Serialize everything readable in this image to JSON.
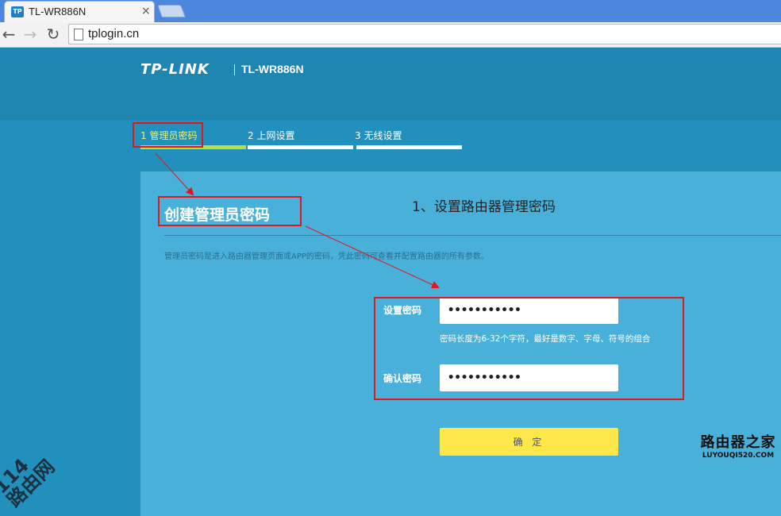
{
  "browser": {
    "tab_title": "TL-WR886N",
    "tab_favicon": "TP",
    "tab_close": "×",
    "back": "←",
    "forward": "→",
    "reload": "↻",
    "url": "tplogin.cn"
  },
  "header": {
    "brand": "TP-LINK",
    "model": "TL-WR886N"
  },
  "steps": [
    {
      "label": "1 管理员密码",
      "active": true
    },
    {
      "label": "2 上网设置",
      "active": false
    },
    {
      "label": "3 无线设置",
      "active": false
    }
  ],
  "panel": {
    "title": "创建管理员密码",
    "annotation": "1、设置路由器管理密码",
    "description": "管理员密码是进入路由器管理页面或APP的密码，凭此密码可查看并配置路由器的所有参数。"
  },
  "form": {
    "password_label": "设置密码",
    "password_value": "•••••••••••",
    "hint": "密码长度为6-32个字符，最好是数字、字母、符号的组合",
    "confirm_label": "确认密码",
    "confirm_value": "•••••••••••",
    "submit_label": "确 定"
  },
  "watermarks": {
    "left_line1": "114",
    "left_line2": "路由网",
    "right_main": "路由器之家",
    "right_sub": "LUYOUQI520.COM"
  },
  "colors": {
    "accent_red": "#e3161e",
    "progress_active": "#b9df3b",
    "button": "#fde74b"
  }
}
